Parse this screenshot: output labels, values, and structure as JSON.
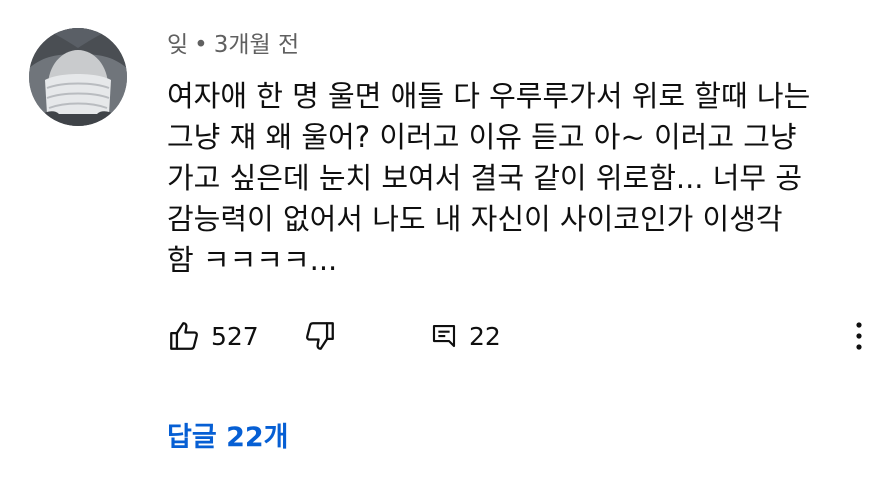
{
  "comment": {
    "author": "잊",
    "separator": "•",
    "time": "3개월 전",
    "text": "여자애 한 명 울면 애들 다 우루루가서 위로 할때 나는\n그냥 쟤 왜 울어? 이러고 이유 듣고 아~ 이러고 그냥\n가고 싶은데 눈치 보여서 결국 같이 위로함... 너무 공\n감능력이 없어서 나도 내 자신이 사이코인가 이생각\n함 ㅋㅋㅋㅋ...",
    "like_count": "527",
    "reply_count": "22",
    "replies_link": "답글 22개"
  },
  "icons": {
    "avatar": "avatar",
    "like": "thumbs-up-icon",
    "dislike": "thumbs-down-icon",
    "reply": "comment-icon",
    "more": "more-vertical-icon"
  },
  "colors": {
    "text": "#0f0f0f",
    "meta": "#606060",
    "link": "#065fd4"
  }
}
